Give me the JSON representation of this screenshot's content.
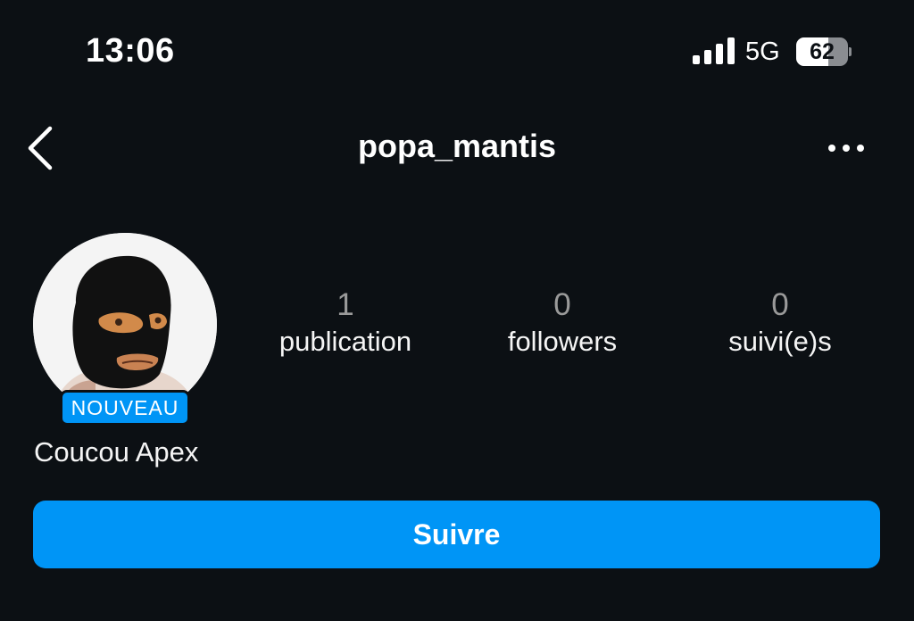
{
  "status_bar": {
    "time": "13:06",
    "network": "5G",
    "battery_level": "62",
    "battery_fraction": 0.62
  },
  "header": {
    "back_icon": "chevron-left-icon",
    "username": "popa_mantis",
    "more_icon": "ellipsis-icon"
  },
  "profile": {
    "avatar_icon": "profile-avatar",
    "new_badge": "NOUVEAU",
    "display_name": "Coucou Apex",
    "stats": [
      {
        "count": "1",
        "label": "publication"
      },
      {
        "count": "0",
        "label": "followers"
      },
      {
        "count": "0",
        "label": "suivi(e)s"
      }
    ],
    "follow_label": "Suivre"
  },
  "colors": {
    "background": "#0c1014",
    "accent": "#0095f6",
    "count_text": "#9a9a9a"
  }
}
